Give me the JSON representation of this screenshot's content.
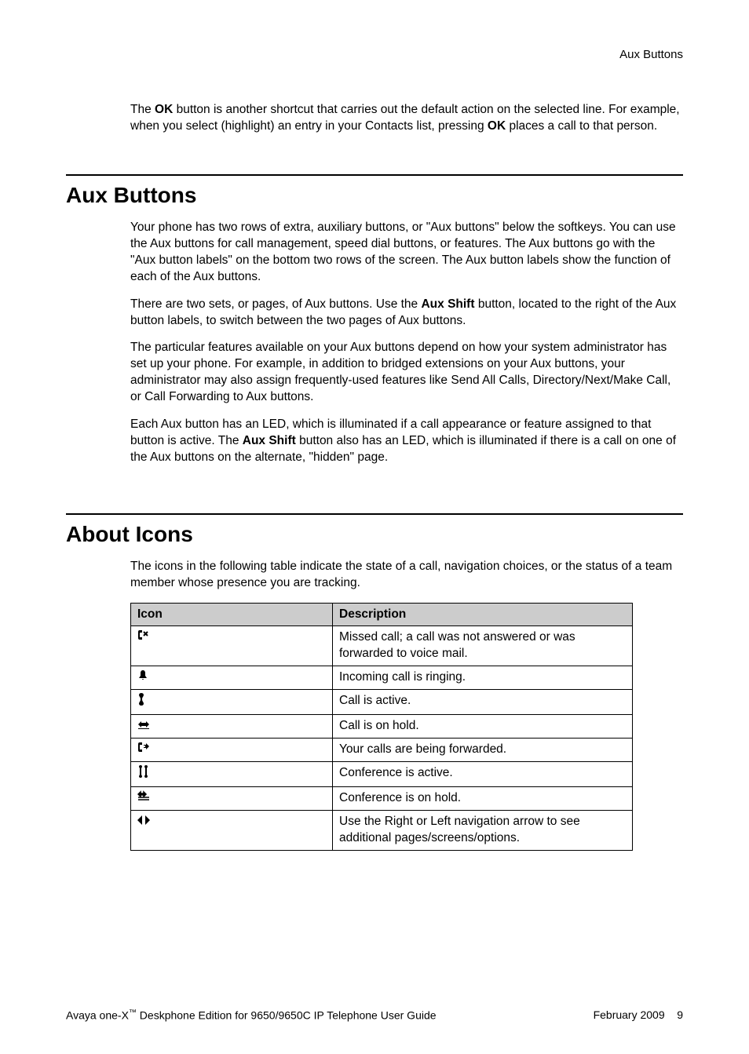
{
  "header": {
    "breadcrumb": "Aux Buttons"
  },
  "intro": {
    "p1_a": "The ",
    "p1_b": "OK",
    "p1_c": " button is another shortcut that carries out the default action on the selected line. For example, when you select (highlight) an entry in your Contacts list, pressing ",
    "p1_d": "OK",
    "p1_e": " places a call to that person."
  },
  "section1": {
    "title": "Aux Buttons",
    "p1": "Your phone has two rows of extra, auxiliary buttons, or \"Aux buttons\" below the softkeys. You can use the Aux buttons for call management, speed dial buttons, or features. The Aux buttons go with the \"Aux button labels\" on the bottom two rows of the screen. The Aux button labels show the function of each of the Aux buttons.",
    "p2_a": "There are two sets, or pages, of Aux buttons. Use the ",
    "p2_b": "Aux Shift",
    "p2_c": " button, located to the right of the Aux button labels, to switch between the two pages of Aux buttons.",
    "p3": "The particular features available on your Aux buttons depend on how your system administrator has set up your phone. For example, in addition to bridged extensions on your Aux buttons, your administrator may also assign frequently-used features like Send All Calls, Directory/Next/Make Call, or Call Forwarding to Aux buttons.",
    "p4_a": "Each Aux button has an LED, which is illuminated if a call appearance or feature assigned to that button is active. The ",
    "p4_b": "Aux Shift",
    "p4_c": " button also has an LED, which is illuminated if there is a call on one of the Aux buttons on the alternate, \"hidden\" page."
  },
  "section2": {
    "title": "About Icons",
    "p1": "The icons in the following table indicate the state of a call, navigation choices, or the status of a team member whose presence you are tracking.",
    "table": {
      "header": {
        "c1": "Icon",
        "c2": "Description"
      },
      "rows": [
        {
          "icon_name": "missed-call-icon",
          "description": "Missed call; a call was not answered or was forwarded to voice mail."
        },
        {
          "icon_name": "ringing-icon",
          "description": "Incoming call is ringing."
        },
        {
          "icon_name": "active-call-icon",
          "description": "Call is active."
        },
        {
          "icon_name": "hold-icon",
          "description": "Call is on hold."
        },
        {
          "icon_name": "forwarded-icon",
          "description": "Your calls are being forwarded."
        },
        {
          "icon_name": "conference-active-icon",
          "description": "Conference is active."
        },
        {
          "icon_name": "conference-hold-icon",
          "description": "Conference is on hold."
        },
        {
          "icon_name": "nav-arrows-icon",
          "description": "Use the Right or Left navigation arrow to see additional pages/screens/options."
        }
      ]
    }
  },
  "footer": {
    "left_a": "Avaya one-X",
    "left_b": " Deskphone Edition for 9650/9650C IP Telephone User Guide",
    "right_date": "February 2009",
    "right_page": "9"
  }
}
